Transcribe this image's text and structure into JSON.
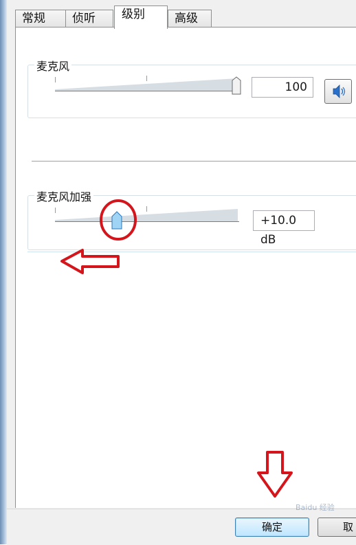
{
  "tabs": [
    {
      "label": "常规"
    },
    {
      "label": "侦听"
    },
    {
      "label": "级别"
    },
    {
      "label": "高级"
    }
  ],
  "active_tab": "级别",
  "microphone": {
    "label": "麦克风",
    "value": "100",
    "level_percent": 100,
    "mute_icon": "speaker-icon"
  },
  "boost": {
    "label": "麦克风加强",
    "value": "+10.0 dB",
    "level_fraction": 0.33
  },
  "buttons": {
    "ok": "确定",
    "cancel": "取"
  },
  "annotation_color": "#d4151c",
  "accent_color": "#3c7fb1"
}
